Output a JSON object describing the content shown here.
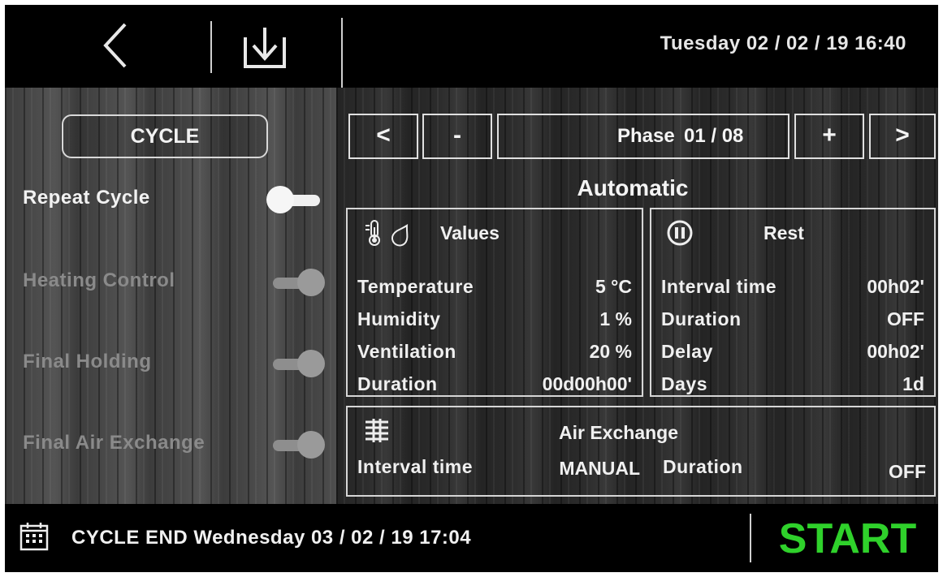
{
  "header": {
    "datetime": "Tuesday 02 / 02 / 19  16:40"
  },
  "left": {
    "cycle_button": "CYCLE",
    "toggles": [
      {
        "label": "Repeat Cycle",
        "state": "on",
        "enabled": true
      },
      {
        "label": "Heating Control",
        "state": "off",
        "enabled": false
      },
      {
        "label": "Final Holding",
        "state": "off",
        "enabled": false
      },
      {
        "label": "Final Air Exchange",
        "state": "off",
        "enabled": false
      }
    ]
  },
  "phase_nav": {
    "prev": "<",
    "minus": "-",
    "phase_label": "Phase",
    "phase_value": "01 / 08",
    "plus": "+",
    "next": ">"
  },
  "mode": "Automatic",
  "values_panel": {
    "title": "Values",
    "icons": [
      "thermometer-icon",
      "droplet-icon"
    ],
    "rows": [
      {
        "label": "Temperature",
        "value": "5 °C"
      },
      {
        "label": "Humidity",
        "value": "1 %"
      },
      {
        "label": "Ventilation",
        "value": "20 %"
      },
      {
        "label": "Duration",
        "value": "00d00h00'"
      }
    ]
  },
  "rest_panel": {
    "title": "Rest",
    "icon": "pause-icon",
    "rows": [
      {
        "label": "Interval time",
        "value": "00h02'"
      },
      {
        "label": "Duration",
        "value": "OFF"
      },
      {
        "label": "Delay",
        "value": "00h02'"
      },
      {
        "label": "Days",
        "value": "1d"
      }
    ]
  },
  "air_exchange": {
    "title": "Air Exchange",
    "icon": "air-exchange-icon",
    "interval_label": "Interval time",
    "interval_value": "MANUAL",
    "duration_label": "Duration",
    "duration_value": "OFF"
  },
  "footer": {
    "cycle_end": "CYCLE END Wednesday 03 / 02 / 19  17:04",
    "start_label": "START",
    "start_color": "#2fd12b"
  },
  "colors": {
    "enabled_text": "#f2f2f2",
    "disabled_text": "#8a8a8a"
  }
}
